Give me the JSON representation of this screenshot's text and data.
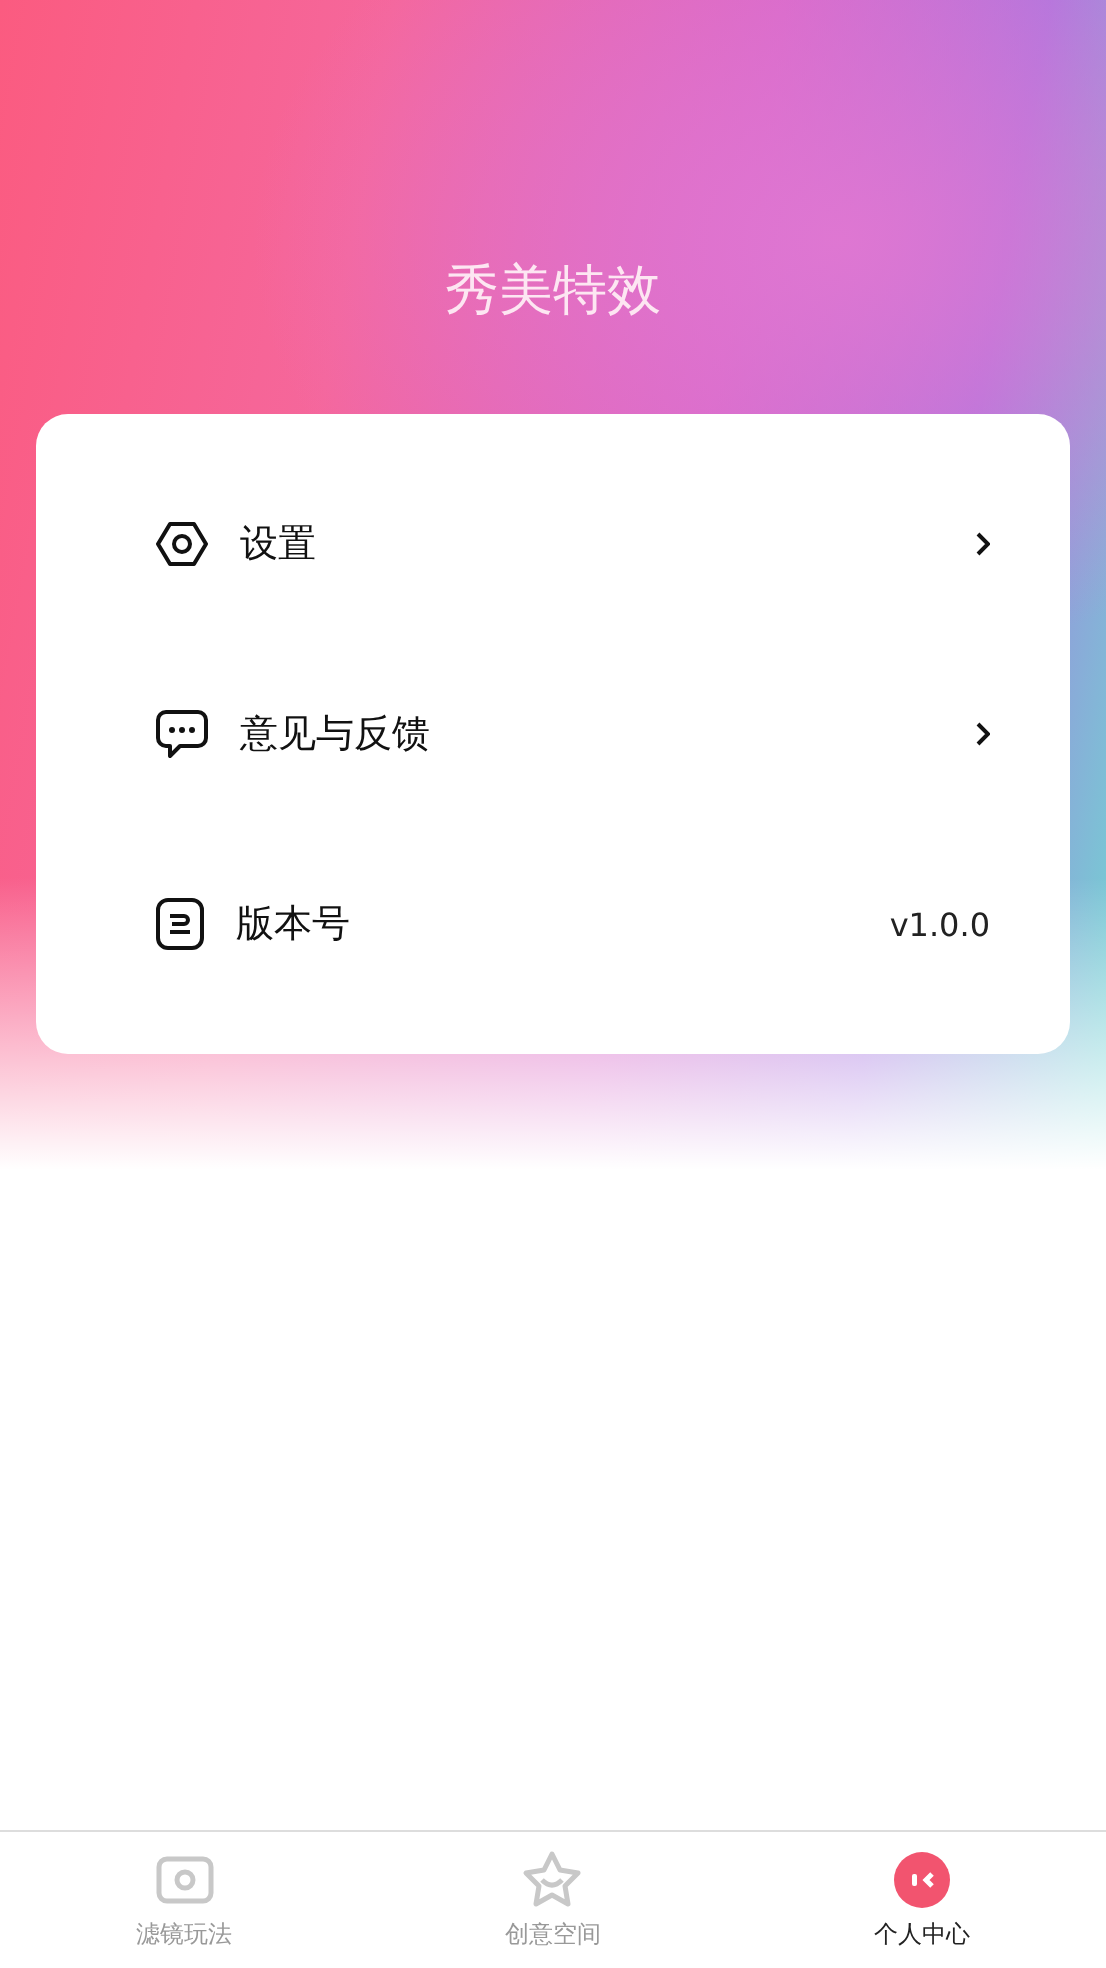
{
  "header": {
    "title": "秀美特效"
  },
  "menu": [
    {
      "kind": "link",
      "label": "设置"
    },
    {
      "kind": "link",
      "label": "意见与反馈"
    },
    {
      "kind": "value",
      "label": "版本号",
      "value": "v1.0.0"
    }
  ],
  "tab_bar": [
    {
      "label": "滤镜玩法",
      "selected": false
    },
    {
      "label": "创意空间",
      "selected": false
    },
    {
      "label": "个人中心",
      "selected": true
    }
  ]
}
